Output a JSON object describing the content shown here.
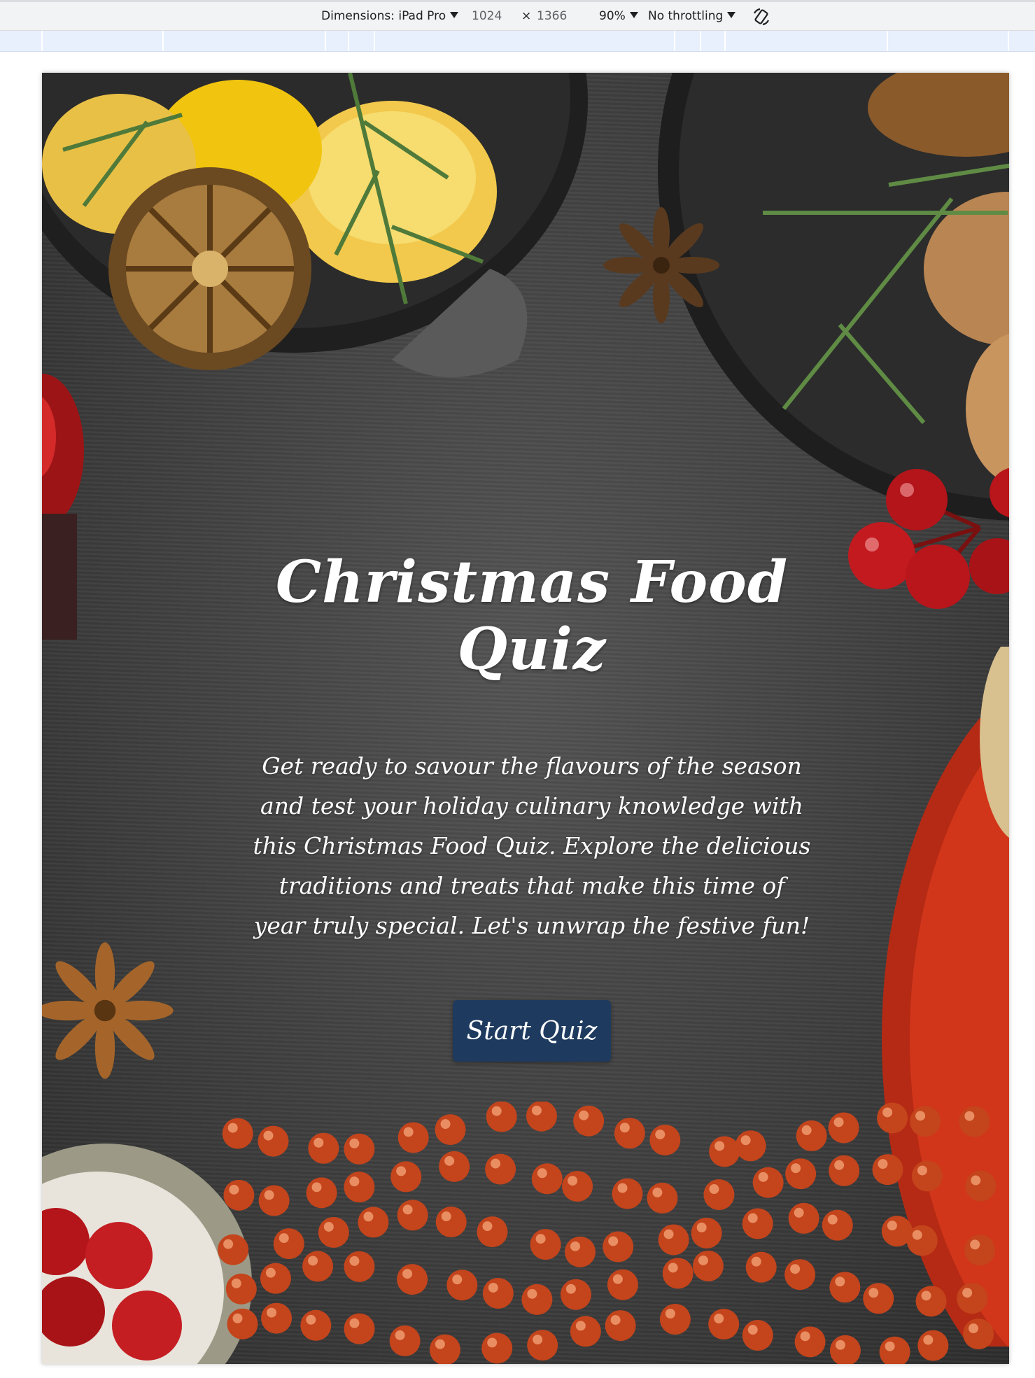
{
  "devtools": {
    "dimensions_label": "Dimensions: iPad Pro",
    "width": "1024",
    "times": "×",
    "height": "1366",
    "zoom": "90%",
    "throttling": "No throttling"
  },
  "page": {
    "title": "Christmas Food Quiz",
    "intro": "Get ready to savour the flavours of the season and test your holiday culinary knowledge with this Christmas Food Quiz. Explore the delicious traditions and treats that make this time of year truly special. Let's unwrap the festive fun!",
    "start_button": "Start Quiz"
  },
  "colors": {
    "button_bg": "#1e3a5f",
    "background": "#3f3f3f",
    "berry_red": "#c0181c",
    "plate_red": "#d2361a",
    "bead_orange": "#c4441c"
  }
}
